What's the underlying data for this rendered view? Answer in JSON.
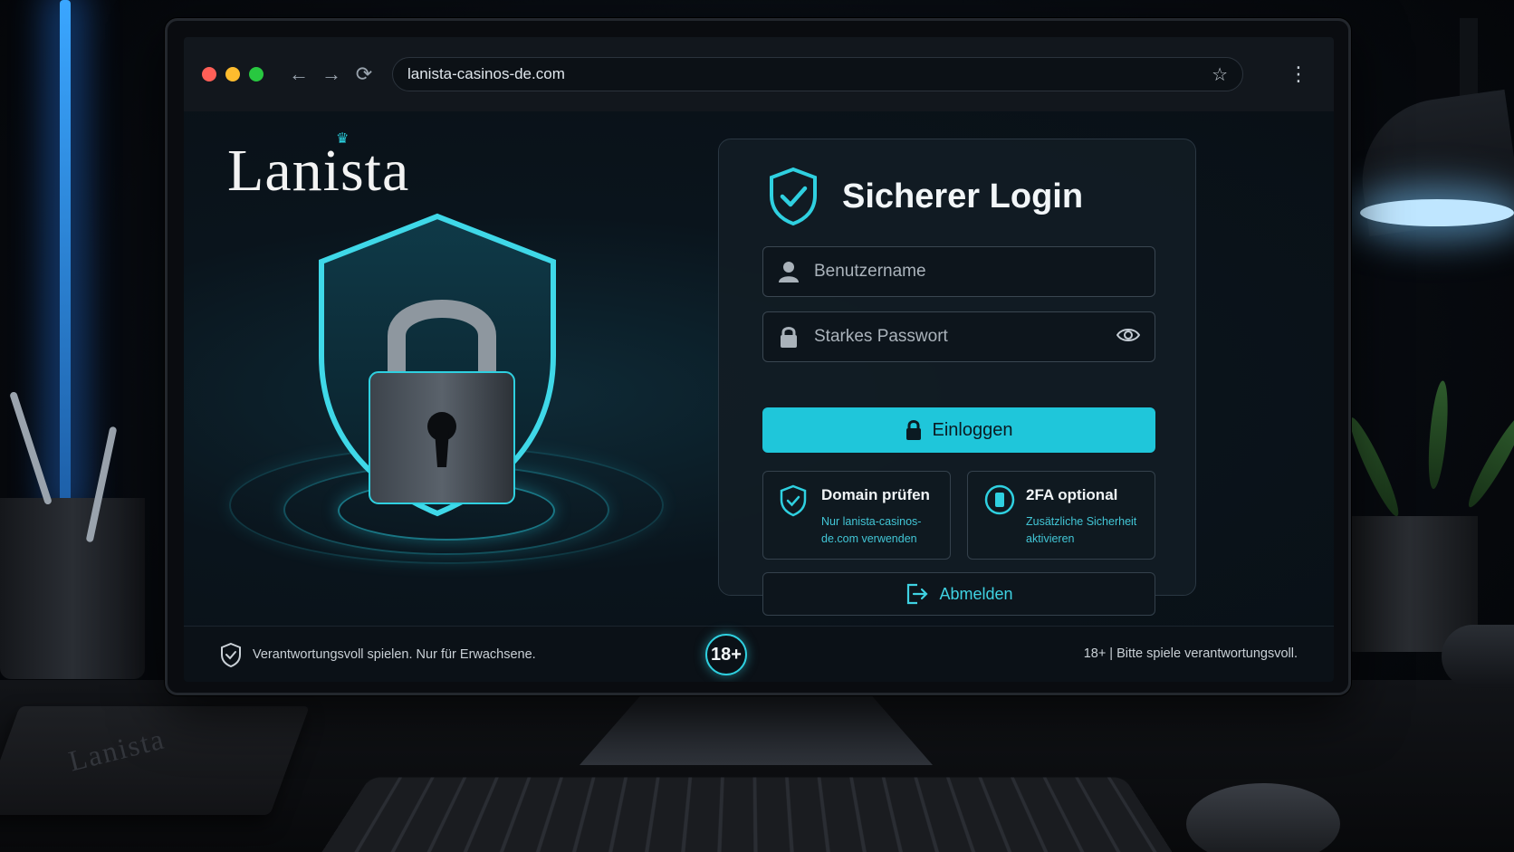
{
  "browser": {
    "url": "lanista-casinos-de.com",
    "nav": {
      "back_icon": "←",
      "forward_icon": "→",
      "reload_icon": "⟳",
      "bookmark_icon": "☆",
      "menu_icon": "⋮"
    },
    "traffic_lights": [
      "#ff5f57",
      "#febc2e",
      "#28c840"
    ]
  },
  "brand": {
    "logo_text": "Lanista",
    "accent_color": "#1fc6da"
  },
  "login": {
    "title": "Sicherer Login",
    "username_placeholder": "Benutzername",
    "password_placeholder": "Starkes Passwort",
    "submit_label": "Einloggen",
    "tiles": [
      {
        "title": "Domain prüfen",
        "subtitle": "Nur lanista-casinos-de.com verwenden"
      },
      {
        "title": "2FA optional",
        "subtitle": "Zusätzliche Sicherheit aktivieren"
      }
    ],
    "logout_label": "Abmelden"
  },
  "footer": {
    "left_text": "Verantwortungsvoll spielen. Nur für Erwachsene.",
    "age_badge": "18+",
    "right_text": "18+  |  Bitte spiele verantwortungsvoll."
  },
  "desk": {
    "notebook_text": "Lanista"
  }
}
